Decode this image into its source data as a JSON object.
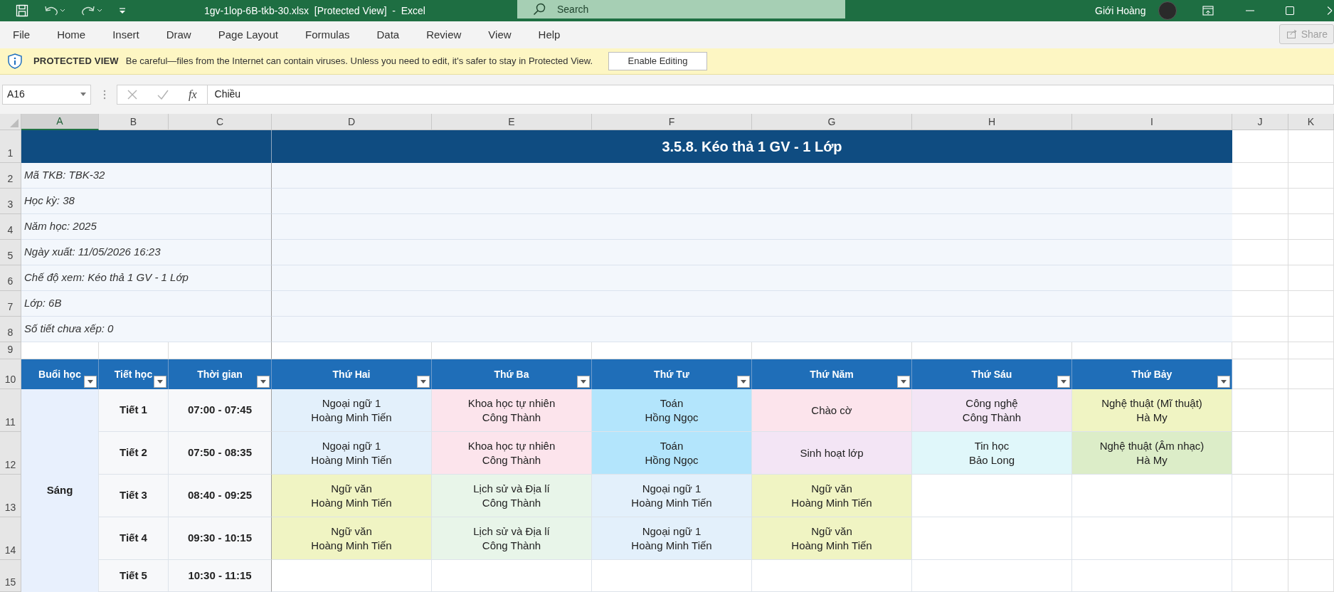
{
  "window": {
    "title": "1gv-1lop-6B-tkb-30.xlsx  [Protected View]  -  Excel",
    "search": {
      "placeholder": "Search"
    },
    "user": "Giới Hoàng"
  },
  "menu": [
    {
      "label": "File"
    },
    {
      "label": "Home"
    },
    {
      "label": "Insert"
    },
    {
      "label": "Draw"
    },
    {
      "label": "Page Layout"
    },
    {
      "label": "Formulas"
    },
    {
      "label": "Data"
    },
    {
      "label": "Review"
    },
    {
      "label": "View"
    },
    {
      "label": "Help"
    }
  ],
  "share_button": {
    "label": "Share",
    "disabled": true
  },
  "protected_view": {
    "label": "PROTECTED VIEW",
    "message": "Be careful—files from the Internet can contain viruses. Unless you need to edit, it's safer to stay in Protected View.",
    "button": "Enable Editing"
  },
  "formula_bar": {
    "name_box": "A16",
    "function_label": "fx",
    "formula": "Chiều"
  },
  "column_headers": [
    {
      "label": "A",
      "selected": true
    },
    {
      "label": "B",
      "selected": false
    },
    {
      "label": "C",
      "selected": false
    },
    {
      "label": "D",
      "selected": false
    },
    {
      "label": "E",
      "selected": false
    },
    {
      "label": "F",
      "selected": false
    },
    {
      "label": "G",
      "selected": false
    },
    {
      "label": "H",
      "selected": false
    },
    {
      "label": "I",
      "selected": false
    },
    {
      "label": "J",
      "selected": false
    },
    {
      "label": "K",
      "selected": false
    }
  ],
  "row_headers": [
    "1",
    "2",
    "3",
    "4",
    "5",
    "6",
    "7",
    "8",
    "9",
    "10",
    "11",
    "12",
    "13",
    "14",
    "15"
  ],
  "sheet_title": "3.5.8. Kéo thả 1 GV - 1 Lớp",
  "info": [
    "Mã TKB: TBK-32",
    "Học kỳ: 38",
    "Năm học: 2025",
    "Ngày xuất: 11/05/2026 16:23",
    "Chế độ xem: Kéo thả 1 GV - 1 Lớp",
    "Lớp: 6B",
    "Số tiết chưa xếp: 0"
  ],
  "table": {
    "headers": [
      {
        "label": "Buổi học",
        "filter": true
      },
      {
        "label": "Tiết học",
        "filter": true
      },
      {
        "label": "Thời gian",
        "filter": true
      },
      {
        "label": "Thứ Hai",
        "filter": true
      },
      {
        "label": "Thứ Ba",
        "filter": true
      },
      {
        "label": "Thứ Tư",
        "filter": true
      },
      {
        "label": "Thứ Năm",
        "filter": true
      },
      {
        "label": "Thứ Sáu",
        "filter": true
      },
      {
        "label": "Thứ Bảy",
        "filter": true
      }
    ],
    "session": "Sáng",
    "periods": [
      {
        "period": "Tiết 1",
        "time": "07:00 - 07:45",
        "cells": [
          {
            "subject": "Ngoại ngữ 1",
            "teacher": "Hoàng Minh Tiến",
            "color": "#e3f0fb"
          },
          {
            "subject": "Khoa học tự nhiên",
            "teacher": "Công Thành",
            "color": "#fce4ec"
          },
          {
            "subject": "Toán",
            "teacher": "Hồng Ngọc",
            "color": "#b3e5fc"
          },
          {
            "subject": "Chào cờ",
            "color": "#fce4ec"
          },
          {
            "subject": "Công nghệ",
            "teacher": "Công Thành",
            "color": "#f3e5f5"
          },
          {
            "subject": "Nghệ thuật (Mĩ thuật)",
            "teacher": "Hà My",
            "color": "#f0f4c3"
          }
        ]
      },
      {
        "period": "Tiết 2",
        "time": "07:50 - 08:35",
        "cells": [
          {
            "subject": "Ngoại ngữ 1",
            "teacher": "Hoàng Minh Tiến",
            "color": "#e3f0fb"
          },
          {
            "subject": "Khoa học tự nhiên",
            "teacher": "Công Thành",
            "color": "#fce4ec"
          },
          {
            "subject": "Toán",
            "teacher": "Hồng Ngọc",
            "color": "#b3e5fc"
          },
          {
            "subject": "Sinh hoạt lớp",
            "color": "#f3e5f5"
          },
          {
            "subject": "Tin học",
            "teacher": "Bảo Long",
            "color": "#e0f7fa"
          },
          {
            "subject": "Nghệ thuật (Âm nhạc)",
            "teacher": "Hà My",
            "color": "#dcedc8"
          }
        ]
      },
      {
        "period": "Tiết 3",
        "time": "08:40 - 09:25",
        "cells": [
          {
            "subject": "Ngữ văn",
            "teacher": "Hoàng Minh Tiến",
            "color": "#f0f4c3"
          },
          {
            "subject": "Lịch sử và Địa lí",
            "teacher": "Công Thành",
            "color": "#e8f5e9"
          },
          {
            "subject": "Ngoại ngữ 1",
            "teacher": "Hoàng Minh Tiến",
            "color": "#e3f0fb"
          },
          {
            "subject": "Ngữ văn",
            "teacher": "Hoàng Minh Tiến",
            "color": "#f0f4c3"
          },
          null,
          null
        ]
      },
      {
        "period": "Tiết 4",
        "time": "09:30 - 10:15",
        "cells": [
          {
            "subject": "Ngữ văn",
            "teacher": "Hoàng Minh Tiến",
            "color": "#f0f4c3"
          },
          {
            "subject": "Lịch sử và Địa lí",
            "teacher": "Công Thành",
            "color": "#e8f5e9"
          },
          {
            "subject": "Ngoại ngữ 1",
            "teacher": "Hoàng Minh Tiến",
            "color": "#e3f0fb"
          },
          {
            "subject": "Ngữ văn",
            "teacher": "Hoàng Minh Tiến",
            "color": "#f0f4c3"
          },
          null,
          null
        ]
      },
      {
        "period": "Tiết 5",
        "time": "10:30 - 11:15",
        "cells": [
          null,
          null,
          null,
          null,
          null,
          null
        ]
      }
    ]
  }
}
